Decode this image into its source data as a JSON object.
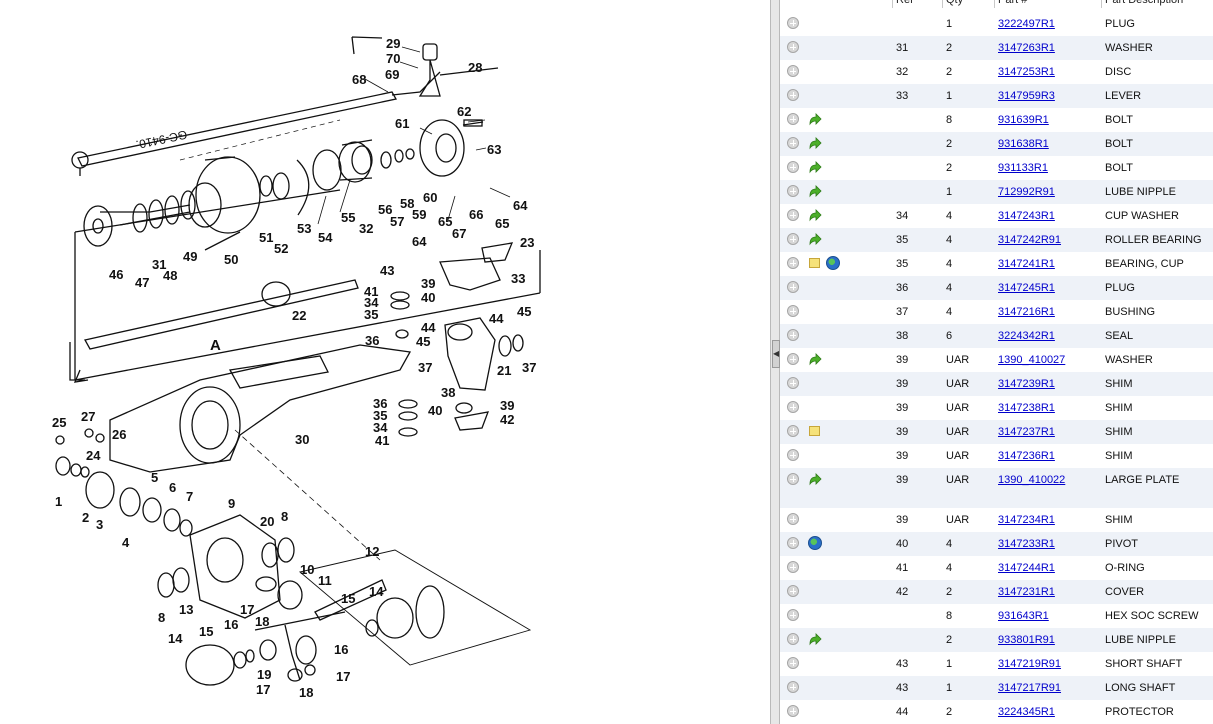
{
  "table": {
    "columns": [
      "Ref",
      "Qty",
      "Part #",
      "Part Description"
    ],
    "rows": [
      {
        "ref": "",
        "qty": "1",
        "part": "3222497R1",
        "desc": "PLUG",
        "icons": []
      },
      {
        "ref": "31",
        "qty": "2",
        "part": "3147263R1",
        "desc": "WASHER",
        "icons": []
      },
      {
        "ref": "32",
        "qty": "2",
        "part": "3147253R1",
        "desc": "DISC",
        "icons": []
      },
      {
        "ref": "33",
        "qty": "1",
        "part": "3147959R3",
        "desc": "LEVER",
        "icons": []
      },
      {
        "ref": "",
        "qty": "8",
        "part": "931639R1",
        "desc": "BOLT",
        "icons": [
          "arrow"
        ]
      },
      {
        "ref": "",
        "qty": "2",
        "part": "931638R1",
        "desc": "BOLT",
        "icons": [
          "arrow"
        ]
      },
      {
        "ref": "",
        "qty": "2",
        "part": "931133R1",
        "desc": "BOLT",
        "icons": [
          "arrow"
        ]
      },
      {
        "ref": "",
        "qty": "1",
        "part": "712992R91",
        "desc": "LUBE NIPPLE",
        "icons": [
          "arrow"
        ]
      },
      {
        "ref": "34",
        "qty": "4",
        "part": "3147243R1",
        "desc": "CUP WASHER",
        "icons": [
          "arrow"
        ]
      },
      {
        "ref": "35",
        "qty": "4",
        "part": "3147242R91",
        "desc": "ROLLER BEARING",
        "icons": [
          "arrow"
        ]
      },
      {
        "ref": "35",
        "qty": "4",
        "part": "3147241R1",
        "desc": "BEARING, CUP",
        "icons": [
          "note",
          "globe"
        ]
      },
      {
        "ref": "36",
        "qty": "4",
        "part": "3147245R1",
        "desc": "PLUG",
        "icons": []
      },
      {
        "ref": "37",
        "qty": "4",
        "part": "3147216R1",
        "desc": "BUSHING",
        "icons": []
      },
      {
        "ref": "38",
        "qty": "6",
        "part": "3224342R1",
        "desc": "SEAL",
        "icons": []
      },
      {
        "ref": "39",
        "qty": "UAR",
        "part": "1390_410027",
        "desc": "WASHER",
        "icons": [
          "arrow"
        ]
      },
      {
        "ref": "39",
        "qty": "UAR",
        "part": "3147239R1",
        "desc": "SHIM",
        "icons": []
      },
      {
        "ref": "39",
        "qty": "UAR",
        "part": "3147238R1",
        "desc": "SHIM",
        "icons": []
      },
      {
        "ref": "39",
        "qty": "UAR",
        "part": "3147237R1",
        "desc": "SHIM",
        "icons": [
          "note"
        ]
      },
      {
        "ref": "39",
        "qty": "UAR",
        "part": "3147236R1",
        "desc": "SHIM",
        "icons": []
      },
      {
        "ref": "39",
        "qty": "UAR",
        "part": "1390_410022",
        "desc": "LARGE PLATE",
        "icons": [
          "arrow"
        ],
        "tall": true
      },
      {
        "ref": "39",
        "qty": "UAR",
        "part": "3147234R1",
        "desc": "SHIM",
        "icons": []
      },
      {
        "ref": "40",
        "qty": "4",
        "part": "3147233R1",
        "desc": "PIVOT",
        "icons": [
          "globe"
        ]
      },
      {
        "ref": "41",
        "qty": "4",
        "part": "3147244R1",
        "desc": "O-RING",
        "icons": []
      },
      {
        "ref": "42",
        "qty": "2",
        "part": "3147231R1",
        "desc": "COVER",
        "icons": []
      },
      {
        "ref": "",
        "qty": "8",
        "part": "931643R1",
        "desc": "HEX SOC SCREW",
        "icons": []
      },
      {
        "ref": "",
        "qty": "2",
        "part": "933801R91",
        "desc": "LUBE NIPPLE",
        "icons": [
          "arrow"
        ]
      },
      {
        "ref": "43",
        "qty": "1",
        "part": "3147219R91",
        "desc": "SHORT SHAFT",
        "icons": []
      },
      {
        "ref": "43",
        "qty": "1",
        "part": "3147217R91",
        "desc": "LONG SHAFT",
        "icons": []
      },
      {
        "ref": "44",
        "qty": "2",
        "part": "3224345R1",
        "desc": "PROTECTOR",
        "icons": []
      }
    ]
  },
  "diagram": {
    "labels": [
      {
        "id": "l29",
        "text": "29"
      },
      {
        "id": "l70",
        "text": "70"
      },
      {
        "id": "l69",
        "text": "69"
      },
      {
        "id": "l28",
        "text": "28"
      },
      {
        "id": "l68",
        "text": "68"
      },
      {
        "id": "l62",
        "text": "62"
      },
      {
        "id": "l61",
        "text": "61"
      },
      {
        "id": "l63",
        "text": "63"
      },
      {
        "id": "l64a",
        "text": "64"
      },
      {
        "id": "l65a",
        "text": "65"
      },
      {
        "id": "l66",
        "text": "66"
      },
      {
        "id": "l67",
        "text": "67"
      },
      {
        "id": "l65b",
        "text": "65"
      },
      {
        "id": "l64b",
        "text": "64"
      },
      {
        "id": "l60",
        "text": "60"
      },
      {
        "id": "l58",
        "text": "58"
      },
      {
        "id": "l59",
        "text": "59"
      },
      {
        "id": "l57",
        "text": "57"
      },
      {
        "id": "l56",
        "text": "56"
      },
      {
        "id": "l55",
        "text": "55"
      },
      {
        "id": "l32",
        "text": "32"
      },
      {
        "id": "l54",
        "text": "54"
      },
      {
        "id": "l53",
        "text": "53"
      },
      {
        "id": "l52",
        "text": "52"
      },
      {
        "id": "l51",
        "text": "51"
      },
      {
        "id": "l50",
        "text": "50"
      },
      {
        "id": "l49",
        "text": "49"
      },
      {
        "id": "l48",
        "text": "48"
      },
      {
        "id": "l31",
        "text": "31"
      },
      {
        "id": "l47",
        "text": "47"
      },
      {
        "id": "l46",
        "text": "46"
      },
      {
        "id": "l23",
        "text": "23"
      },
      {
        "id": "l33",
        "text": "33"
      },
      {
        "id": "l39a",
        "text": "39"
      },
      {
        "id": "l40a",
        "text": "40"
      },
      {
        "id": "l43",
        "text": "43"
      },
      {
        "id": "l41a",
        "text": "41"
      },
      {
        "id": "l34a",
        "text": "34"
      },
      {
        "id": "l35a",
        "text": "35"
      },
      {
        "id": "l22",
        "text": "22"
      },
      {
        "id": "l44a",
        "text": "44"
      },
      {
        "id": "l44b",
        "text": "44"
      },
      {
        "id": "l45a",
        "text": "45"
      },
      {
        "id": "l45b",
        "text": "45"
      },
      {
        "id": "lA",
        "text": "A"
      },
      {
        "id": "l36a",
        "text": "36"
      },
      {
        "id": "l37a",
        "text": "37"
      },
      {
        "id": "l37b",
        "text": "37"
      },
      {
        "id": "l38",
        "text": "38"
      },
      {
        "id": "l21",
        "text": "21"
      },
      {
        "id": "l36b",
        "text": "36"
      },
      {
        "id": "l35b",
        "text": "35"
      },
      {
        "id": "l34b",
        "text": "34"
      },
      {
        "id": "l41b",
        "text": "41"
      },
      {
        "id": "l40b",
        "text": "40"
      },
      {
        "id": "l39b",
        "text": "39"
      },
      {
        "id": "l42",
        "text": "42"
      },
      {
        "id": "l30",
        "text": "30"
      },
      {
        "id": "l25",
        "text": "25"
      },
      {
        "id": "l27",
        "text": "27"
      },
      {
        "id": "l26",
        "text": "26"
      },
      {
        "id": "l24",
        "text": "24"
      },
      {
        "id": "l1",
        "text": "1"
      },
      {
        "id": "l2",
        "text": "2"
      },
      {
        "id": "l3",
        "text": "3"
      },
      {
        "id": "l4",
        "text": "4"
      },
      {
        "id": "l5",
        "text": "5"
      },
      {
        "id": "l6",
        "text": "6"
      },
      {
        "id": "l7",
        "text": "7"
      },
      {
        "id": "l9",
        "text": "9"
      },
      {
        "id": "l20",
        "text": "20"
      },
      {
        "id": "l8a",
        "text": "8"
      },
      {
        "id": "l10",
        "text": "10"
      },
      {
        "id": "l11",
        "text": "11"
      },
      {
        "id": "l12",
        "text": "12"
      },
      {
        "id": "l8b",
        "text": "8"
      },
      {
        "id": "l13",
        "text": "13"
      },
      {
        "id": "l14a",
        "text": "14"
      },
      {
        "id": "l15a",
        "text": "15"
      },
      {
        "id": "l17a",
        "text": "17"
      },
      {
        "id": "l18a",
        "text": "18"
      },
      {
        "id": "l16a",
        "text": "16"
      },
      {
        "id": "l14b",
        "text": "14"
      },
      {
        "id": "l15b",
        "text": "15"
      },
      {
        "id": "l16b",
        "text": "16"
      },
      {
        "id": "l19",
        "text": "19"
      },
      {
        "id": "l17b",
        "text": "17"
      },
      {
        "id": "l18b",
        "text": "18"
      },
      {
        "id": "l17c",
        "text": "17"
      },
      {
        "id": "lcode",
        "text": "GC-9410."
      }
    ]
  }
}
